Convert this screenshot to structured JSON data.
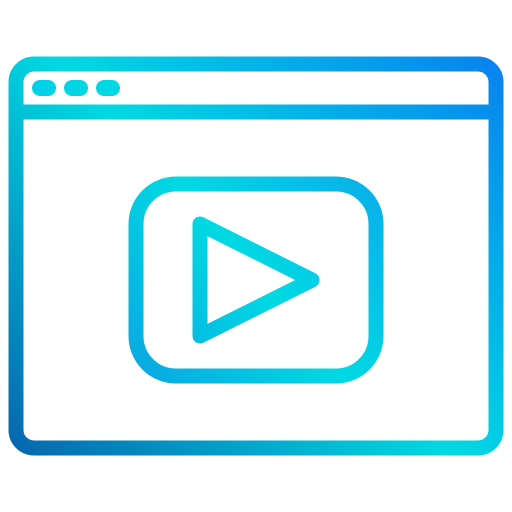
{
  "icon": {
    "name": "video-browser-window-icon",
    "parts": {
      "window": "browser-window-icon",
      "dots": "window-control-dots-icon",
      "player": "video-player-icon",
      "play": "play-icon"
    },
    "colors": {
      "gradient_cyan": "#00D9E3",
      "gradient_blue": "#0A74F0",
      "gradient_navy": "#0754A6",
      "background": "#FFFFFF"
    }
  }
}
